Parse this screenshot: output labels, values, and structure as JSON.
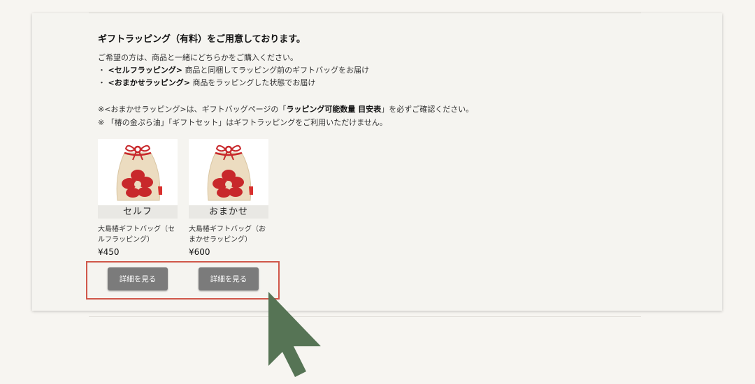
{
  "notice": {
    "heading": "ギフトラッピング（有料）をご用意しております。",
    "intro": "ご希望の方は、商品と一緒にどちらかをご購入ください。",
    "options": [
      {
        "bullet": "・",
        "label": "<セルフラッピング>",
        "desc": "商品と同梱してラッピング前のギフトバッグをお届け"
      },
      {
        "bullet": "・",
        "label": "<おまかせラッピング>",
        "desc": "商品をラッピングした状態でお届け"
      }
    ],
    "note1": {
      "pre": "※<おまかせラッピング>は、ギフトバッグページの「",
      "bold": "ラッピング可能数量 目安表",
      "post": "」を必ずご確認ください。"
    },
    "note2": "※ 「椿の金ぷら油」「ギフトセット」はギフトラッピングをご利用いただけません。"
  },
  "products": [
    {
      "tag": "セルフ",
      "name": "大島椿ギフトバッグ（セルフラッピング）",
      "price": "¥450",
      "button": "詳細を見る"
    },
    {
      "tag": "おまかせ",
      "name": "大島椿ギフトバッグ（おまかせラッピング）",
      "price": "¥600",
      "button": "詳細を見る"
    }
  ],
  "colors": {
    "button_bg": "#7b7b7b",
    "highlight": "#d0574a",
    "cursor": "#567455",
    "bag": "#ecdcc0",
    "flower": "#c8282b"
  }
}
